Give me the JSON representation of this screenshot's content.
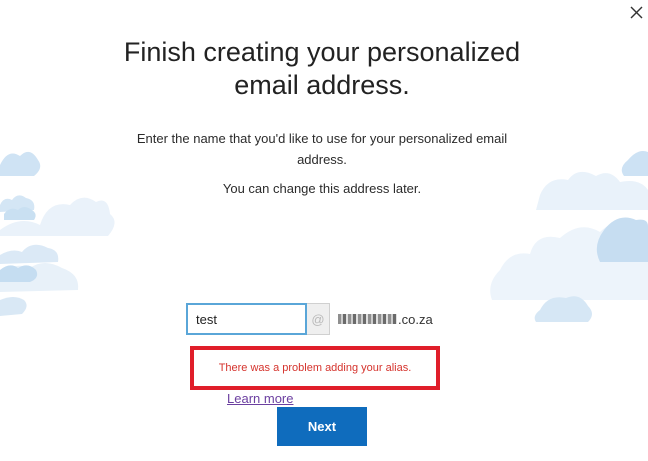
{
  "dialog": {
    "title_line1": "Finish creating your personalized",
    "title_line2": "email address.",
    "description_line1": "Enter the name that you'd like to use for your personalized email",
    "description_line2": "address.",
    "subnote": "You can change this address later.",
    "close_icon": "close-icon"
  },
  "alias": {
    "value": "test",
    "at_symbol": "@",
    "domain_suffix": ".co.za"
  },
  "error": {
    "message": "There was a problem adding your alias.",
    "highlight_color": "#e01e2a",
    "text_color": "#d5332d"
  },
  "learn_more": "Learn more",
  "next_button": "Next",
  "colors": {
    "accent": "#0f6cbd",
    "input_border": "#5aa6d8",
    "link": "#6b3fa0",
    "cloud_light": "#eaf3fb",
    "cloud_mid": "#c9e0f3"
  }
}
